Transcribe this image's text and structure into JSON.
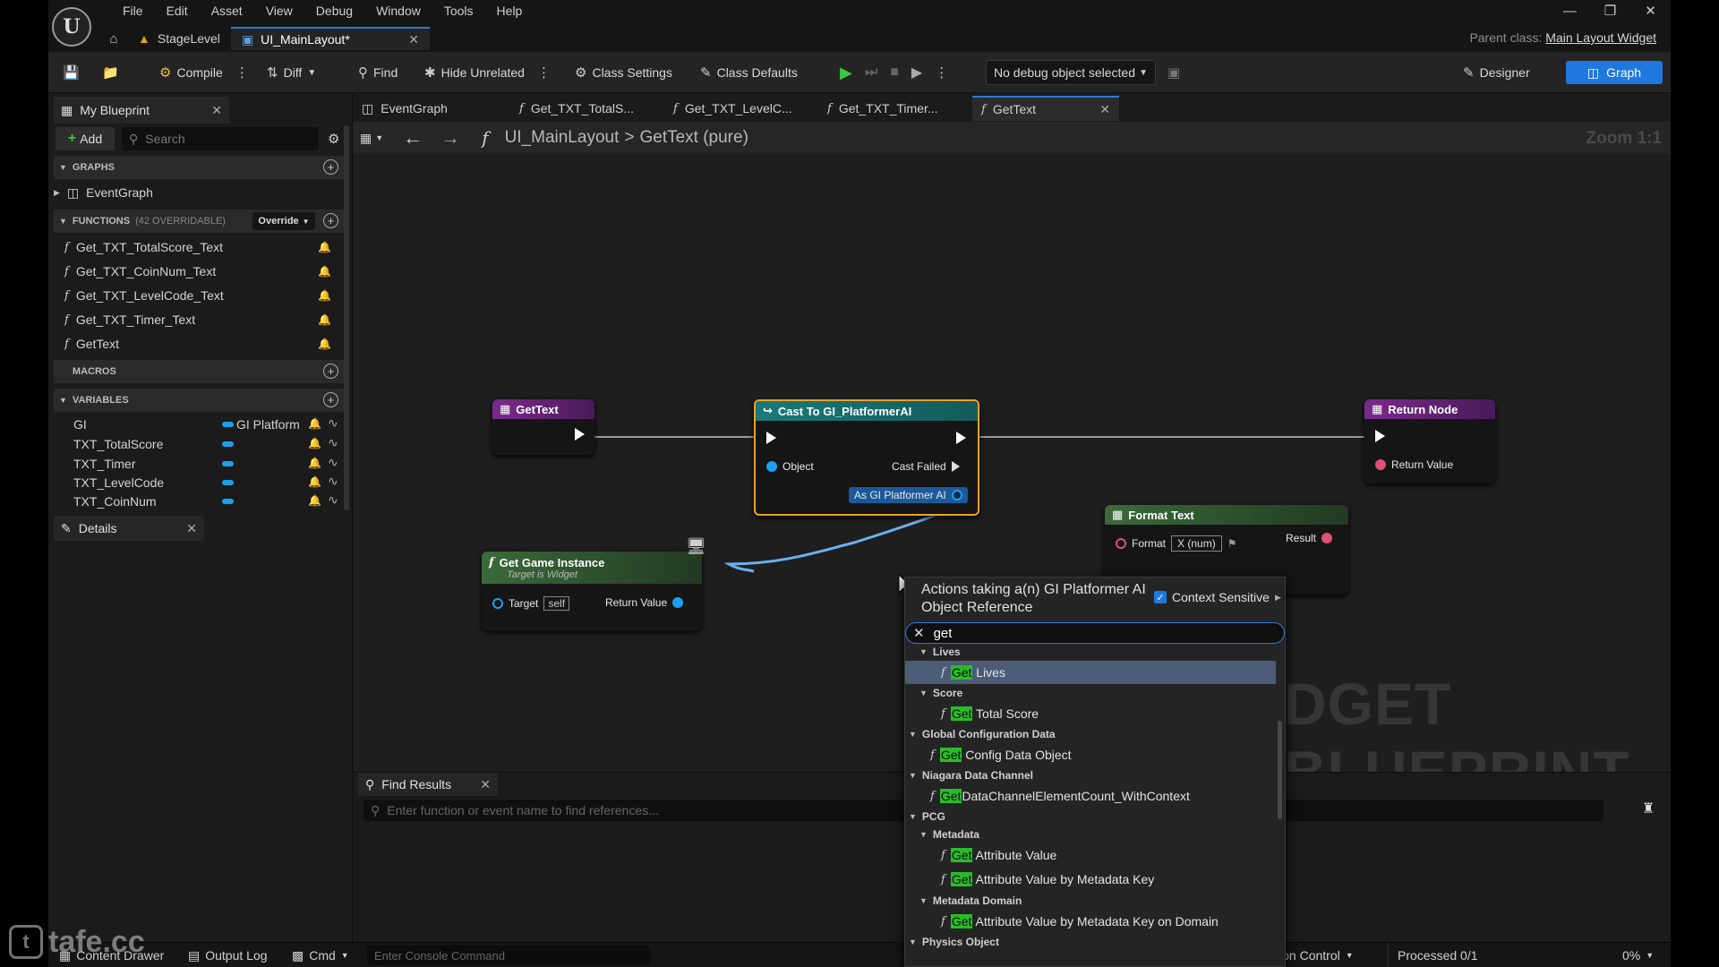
{
  "menu": {
    "items": [
      "File",
      "Edit",
      "Asset",
      "View",
      "Debug",
      "Window",
      "Tools",
      "Help"
    ]
  },
  "doc_tabs": [
    {
      "label": "StageLevel"
    },
    {
      "label": "UI_MainLayout*"
    }
  ],
  "parent_class": {
    "label": "Parent class:",
    "value": "Main Layout Widget"
  },
  "toolbar": {
    "compile": "Compile",
    "diff": "Diff",
    "find": "Find",
    "hide_unrelated": "Hide Unrelated",
    "class_settings": "Class Settings",
    "class_defaults": "Class Defaults",
    "debug_select": "No debug object selected",
    "designer": "Designer",
    "graph": "Graph"
  },
  "my_blueprint": {
    "tab": "My Blueprint",
    "add": "Add",
    "search_placeholder": "Search",
    "graphs_header": "GRAPHS",
    "graphs": [
      "EventGraph"
    ],
    "functions_header": "FUNCTIONS",
    "functions_count": "(42 OVERRIDABLE)",
    "override": "Override",
    "functions": [
      "Get_TXT_TotalScore_Text",
      "Get_TXT_CoinNum_Text",
      "Get_TXT_LevelCode_Text",
      "Get_TXT_Timer_Text",
      "GetText"
    ],
    "macros_header": "MACROS",
    "variables_header": "VARIABLES",
    "variables": [
      {
        "name": "GI",
        "type": "GI Platform"
      },
      {
        "name": "TXT_TotalScore",
        "type": ""
      },
      {
        "name": "TXT_Timer",
        "type": ""
      },
      {
        "name": "TXT_LevelCode",
        "type": ""
      },
      {
        "name": "TXT_CoinNum",
        "type": ""
      }
    ],
    "details_tab": "Details"
  },
  "graph_tabs": [
    "EventGraph",
    "Get_TXT_TotalS...",
    "Get_TXT_LevelC...",
    "Get_TXT_Timer...",
    "GetText"
  ],
  "breadcrumb": {
    "root": "UI_MainLayout",
    "sep": ">",
    "current": "GetText (pure)"
  },
  "zoom": "Zoom 1:1",
  "watermark": "DGET BLUEPRINT",
  "nodes": {
    "gettext": {
      "title": "GetText"
    },
    "cast": {
      "title": "Cast To GI_PlatformerAI",
      "object": "Object",
      "cast_failed": "Cast Failed",
      "as": "As GI Platformer AI"
    },
    "game_instance": {
      "title": "Get Game Instance",
      "subtitle": "Target is Widget",
      "target": "Target",
      "self": "self",
      "return": "Return Value"
    },
    "format_text": {
      "title": "Format Text",
      "format": "Format",
      "format_value": "X (num)",
      "result": "Result"
    },
    "return_node": {
      "title": "Return Node",
      "return": "Return Value"
    }
  },
  "context_menu": {
    "title": "Actions taking a(n) GI Platformer AI Object Reference",
    "context_sensitive": "Context Sensitive",
    "search_value": "get",
    "categories": [
      {
        "name": "Lives",
        "actions": [
          {
            "hl": "Get",
            "rest": " Lives"
          }
        ]
      },
      {
        "name": "Score",
        "actions": [
          {
            "hl": "Get",
            "rest": " Total Score"
          }
        ]
      },
      {
        "name": "Global Configuration Data",
        "actions": [
          {
            "hl": "Get",
            "rest": " Config Data Object"
          }
        ]
      },
      {
        "name": "Niagara Data Channel",
        "actions": [
          {
            "hl": "Get",
            "rest": "DataChannelElementCount_WithContext"
          }
        ]
      },
      {
        "name": "PCG",
        "actions": []
      },
      {
        "name": "Metadata",
        "actions": [
          {
            "hl": "Get",
            "rest": " Attribute Value"
          },
          {
            "hl": "Get",
            "rest": " Attribute Value by Metadata Key"
          }
        ]
      },
      {
        "name": "Metadata Domain",
        "actions": [
          {
            "hl": "Get",
            "rest": " Attribute Value by Metadata Key on Domain"
          }
        ]
      },
      {
        "name": "Physics Object",
        "actions": []
      }
    ]
  },
  "find_results": {
    "tab": "Find Results",
    "placeholder": "Enter function or event name to find references..."
  },
  "status": {
    "content_drawer": "Content Drawer",
    "output_log": "Output Log",
    "cmd": "Cmd",
    "console_placeholder": "Enter Console Command",
    "revision_control": "Revision Control",
    "processed": "Processed 0/1",
    "percent": "0%"
  },
  "overlay_logo": "tafe.cc"
}
